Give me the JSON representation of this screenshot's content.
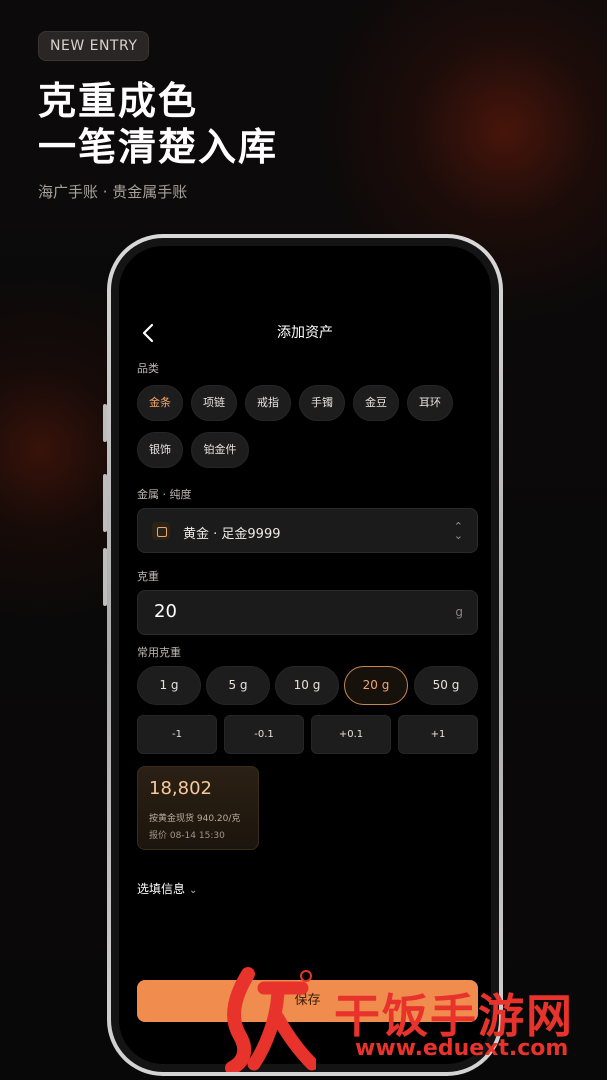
{
  "badge": "NEW ENTRY",
  "headline": {
    "line1": "克重成色",
    "line2": "一笔清楚入库"
  },
  "subtitle": "海广手账 · 贵金属手账",
  "screen": {
    "title": "添加资产",
    "category_label": "品类",
    "categories": [
      {
        "label": "金条",
        "active": true
      },
      {
        "label": "项链"
      },
      {
        "label": "戒指"
      },
      {
        "label": "手镯"
      },
      {
        "label": "金豆"
      },
      {
        "label": "耳环"
      },
      {
        "label": "银饰"
      },
      {
        "label": "铂金件"
      }
    ],
    "metal_label": "金属 · 纯度",
    "metal_value": "黄金 · 足金9999",
    "weight_label": "克重",
    "weight_value": "20",
    "weight_unit": "g",
    "common_label": "常用克重",
    "common_weights": [
      "1 g",
      "5 g",
      "10 g",
      "20 g",
      "50 g"
    ],
    "common_selected": "20 g",
    "steps": [
      "-1",
      "-0.1",
      "+0.1",
      "+1"
    ],
    "valuation": {
      "amount": "18,802",
      "basis": "按黄金现货 940.20/克",
      "quote_time": "报价 08-14 15:30"
    },
    "optional_info": "选填信息",
    "save_label": "保存"
  },
  "watermark": {
    "text": "干饭手游网",
    "url": "www.eduext.com"
  },
  "colors": {
    "accent": "#f08d4e",
    "background": "#070606",
    "watermark": "#e8332c"
  }
}
